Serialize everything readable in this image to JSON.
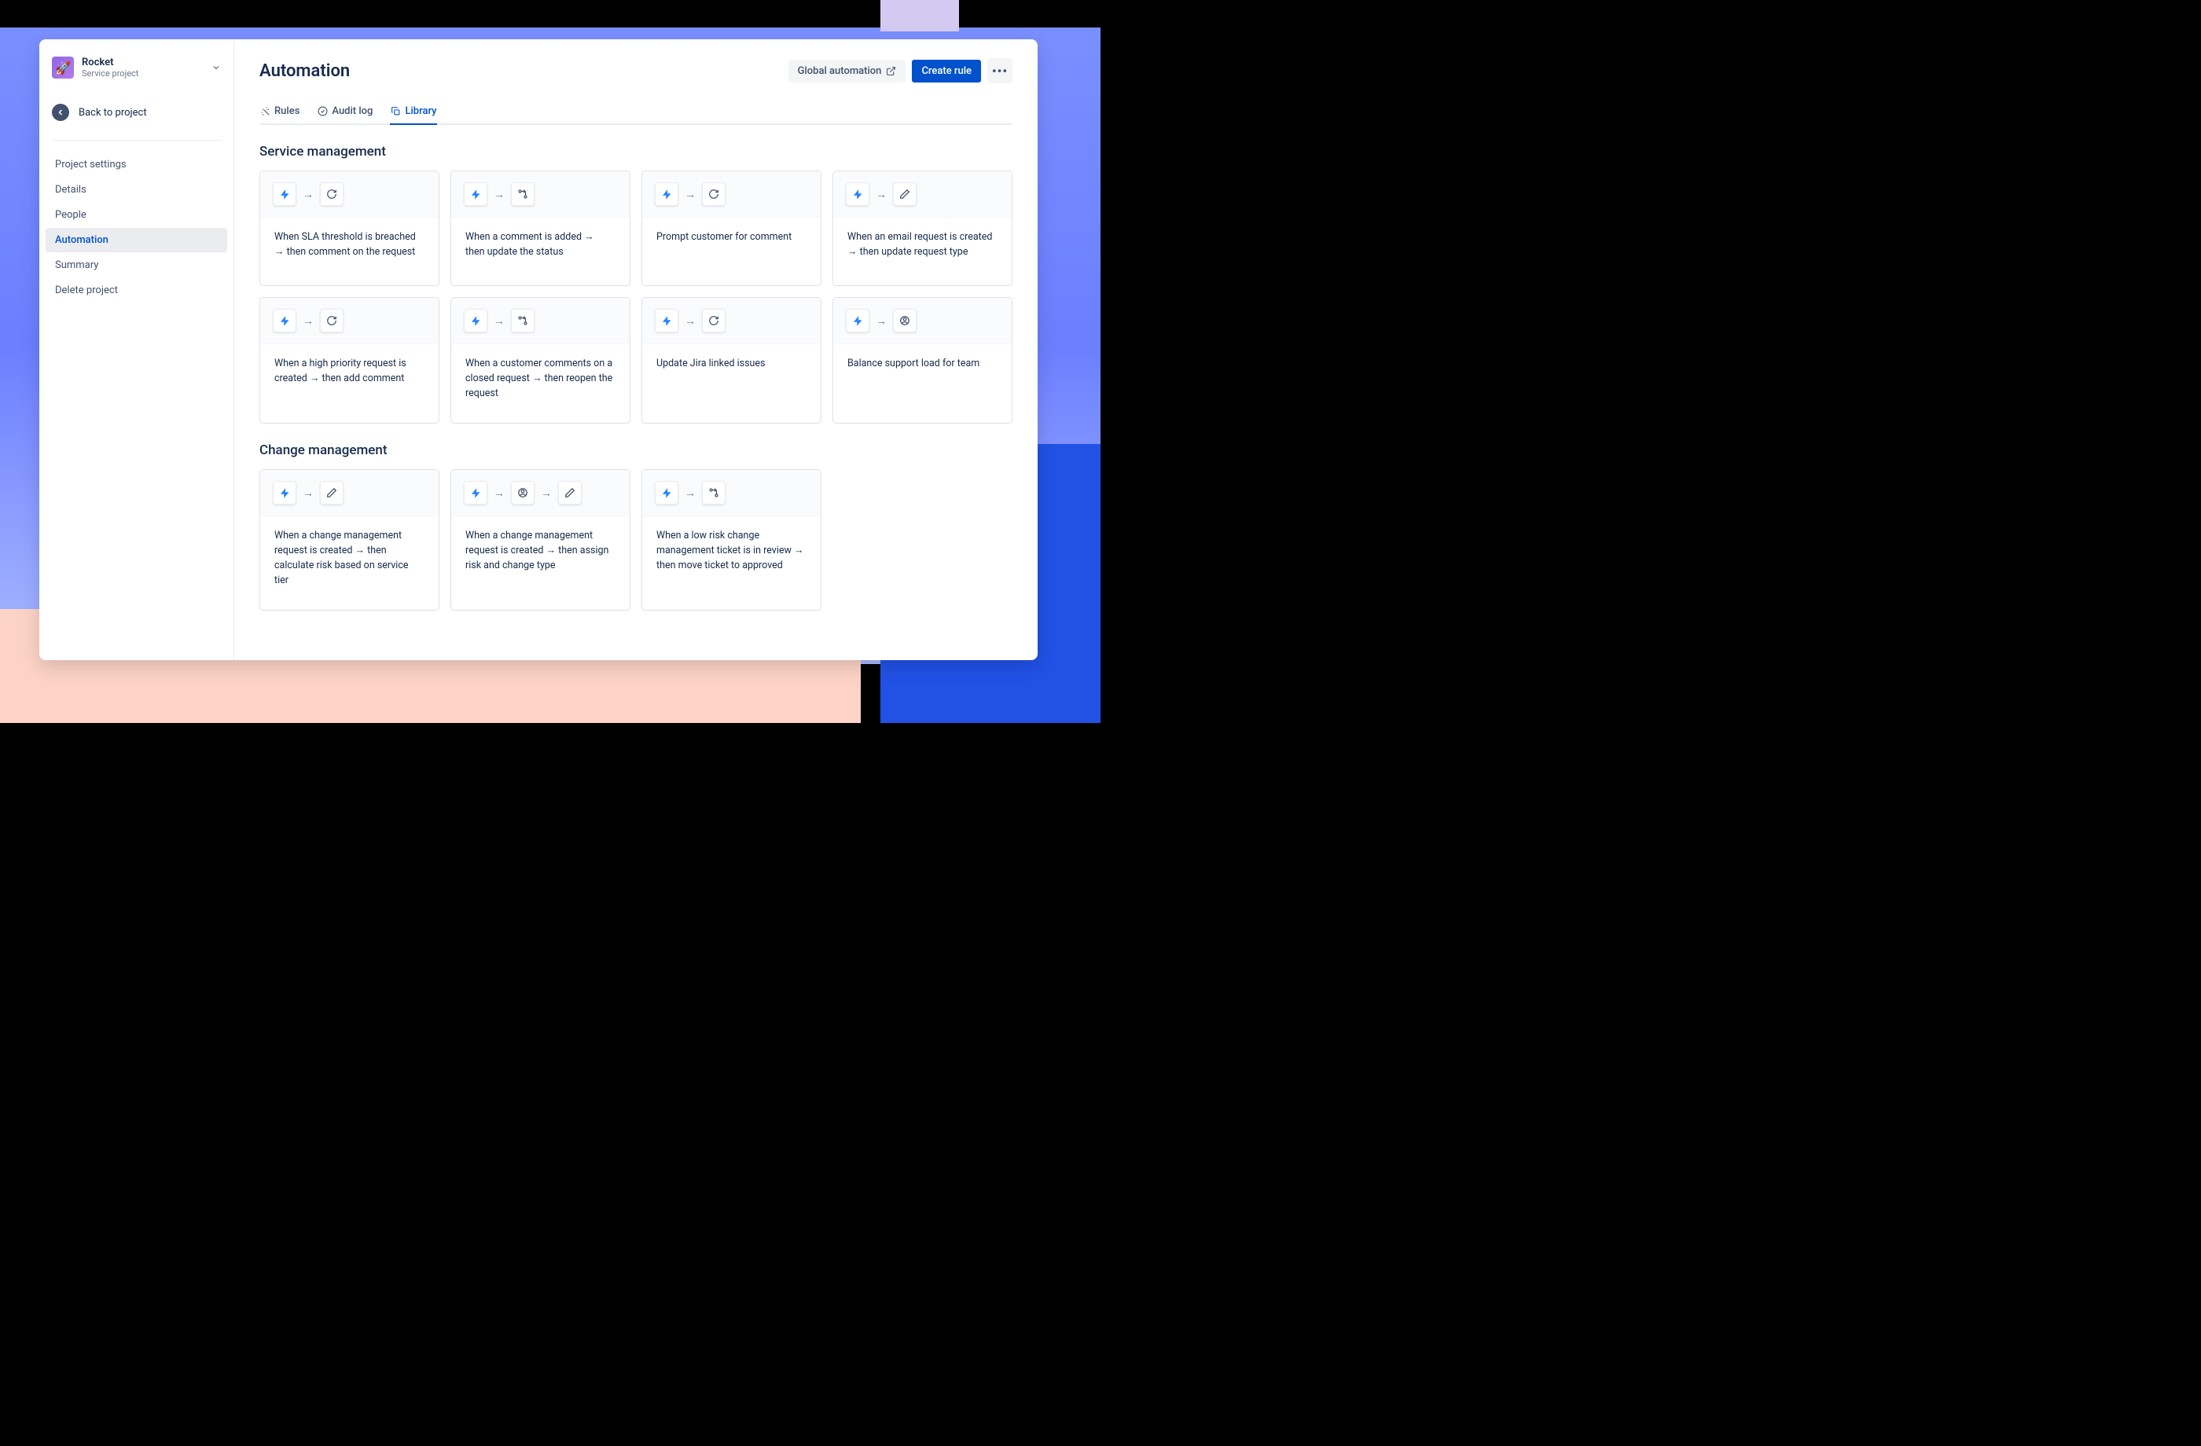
{
  "sidebar": {
    "project_name": "Rocket",
    "project_type": "Service project",
    "back_label": "Back to project",
    "nav": [
      {
        "label": "Project settings",
        "active": false
      },
      {
        "label": "Details",
        "active": false
      },
      {
        "label": "People",
        "active": false
      },
      {
        "label": "Automation",
        "active": true
      },
      {
        "label": "Summary",
        "active": false
      },
      {
        "label": "Delete project",
        "active": false
      }
    ]
  },
  "header": {
    "title": "Automation",
    "global_btn": "Global automation",
    "create_btn": "Create rule"
  },
  "tabs": [
    {
      "label": "Rules",
      "icon": "wand",
      "active": false
    },
    {
      "label": "Audit log",
      "icon": "check-circle",
      "active": false
    },
    {
      "label": "Library",
      "icon": "copy",
      "active": true
    }
  ],
  "sections": [
    {
      "title": "Service management",
      "cards": [
        {
          "icons": [
            "bolt",
            "refresh"
          ],
          "text": "When SLA threshold is breached → then comment on the request"
        },
        {
          "icons": [
            "bolt",
            "branch"
          ],
          "text": "When a comment is added → then update the status"
        },
        {
          "icons": [
            "bolt",
            "refresh"
          ],
          "text": "Prompt customer for comment"
        },
        {
          "icons": [
            "bolt",
            "pencil"
          ],
          "text": "When an email request is created → then update request type"
        },
        {
          "icons": [
            "bolt",
            "refresh"
          ],
          "text": "When a high priority request is created → then add comment"
        },
        {
          "icons": [
            "bolt",
            "branch"
          ],
          "text": "When a customer comments on a closed request → then reopen the request"
        },
        {
          "icons": [
            "bolt",
            "refresh"
          ],
          "text": "Update Jira linked issues"
        },
        {
          "icons": [
            "bolt",
            "person"
          ],
          "text": "Balance support load for team"
        }
      ]
    },
    {
      "title": "Change management",
      "cards": [
        {
          "icons": [
            "bolt",
            "pencil"
          ],
          "text": "When a change management request is created → then calculate risk based on service tier"
        },
        {
          "icons": [
            "bolt",
            "person",
            "pencil"
          ],
          "text": "When a change management request is created → then assign risk and change type"
        },
        {
          "icons": [
            "bolt",
            "branch"
          ],
          "text": "When a low risk change management ticket is in review → then move ticket to approved"
        }
      ]
    }
  ],
  "icons": {
    "bolt": "bolt-icon",
    "refresh": "refresh-icon",
    "branch": "branch-icon",
    "pencil": "pencil-icon",
    "person": "person-icon"
  },
  "colors": {
    "primary": "#0052cc",
    "text": "#172b4d",
    "bolt": "#2684ff"
  }
}
